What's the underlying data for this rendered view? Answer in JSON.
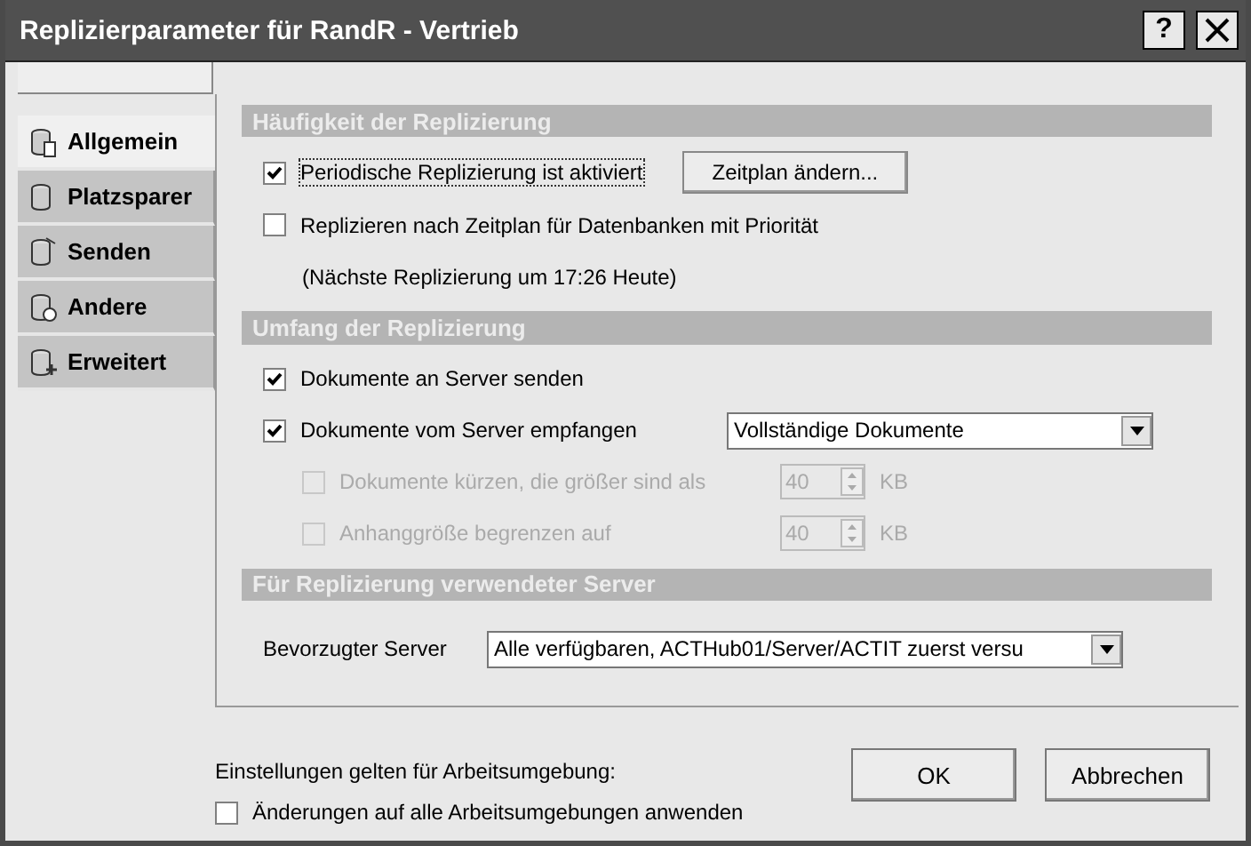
{
  "window": {
    "title": "Replizierparameter für RandR - Vertrieb",
    "help_button": "?"
  },
  "sidebar": {
    "items": [
      {
        "label": "Allgemein",
        "selected": true
      },
      {
        "label": "Platzsparer",
        "selected": false
      },
      {
        "label": "Senden",
        "selected": false
      },
      {
        "label": "Andere",
        "selected": false
      },
      {
        "label": "Erweitert",
        "selected": false
      }
    ]
  },
  "sections": [
    {
      "title": "Häufigkeit der Replizierung",
      "rows": [
        {
          "kind": "checkbox",
          "label": "Periodische Replizierung ist aktiviert",
          "checked": true,
          "disabled": false,
          "focused": true,
          "button": "Zeitplan ändern..."
        },
        {
          "kind": "checkbox",
          "label": "Replizieren nach Zeitplan für Datenbanken mit Priorität",
          "checked": false,
          "disabled": false,
          "focused": false
        },
        {
          "kind": "note",
          "label": "(Nächste Replizierung um 17:26 Heute)"
        }
      ]
    },
    {
      "title": "Umfang der Replizierung",
      "rows": [
        {
          "kind": "checkbox",
          "label": "Dokumente an Server senden",
          "checked": true,
          "disabled": false,
          "focused": false
        },
        {
          "kind": "checkbox",
          "label": "Dokumente vom Server empfangen",
          "checked": true,
          "disabled": false,
          "focused": false,
          "select": "Vollständige Dokumente"
        },
        {
          "kind": "spin",
          "label": "Dokumente kürzen, die größer sind als",
          "checked": false,
          "disabled": true,
          "value": "40",
          "unit": "KB"
        },
        {
          "kind": "spin",
          "label": "Anhanggröße begrenzen auf",
          "checked": false,
          "disabled": true,
          "value": "40",
          "unit": "KB"
        }
      ]
    },
    {
      "title": "Für Replizierung verwendeter Server",
      "rows": [
        {
          "kind": "select",
          "label": "Bevorzugter Server",
          "select": "Alle verfügbaren, ACTHub01/Server/ACTIT zuerst versu"
        }
      ]
    }
  ],
  "footer": {
    "note": "Einstellungen gelten für Arbeitsumgebung:",
    "checkbox": {
      "label": "Änderungen auf alle Arbeitsumgebungen anwenden",
      "checked": false
    },
    "buttons": [
      "OK",
      "Abbrechen"
    ]
  }
}
